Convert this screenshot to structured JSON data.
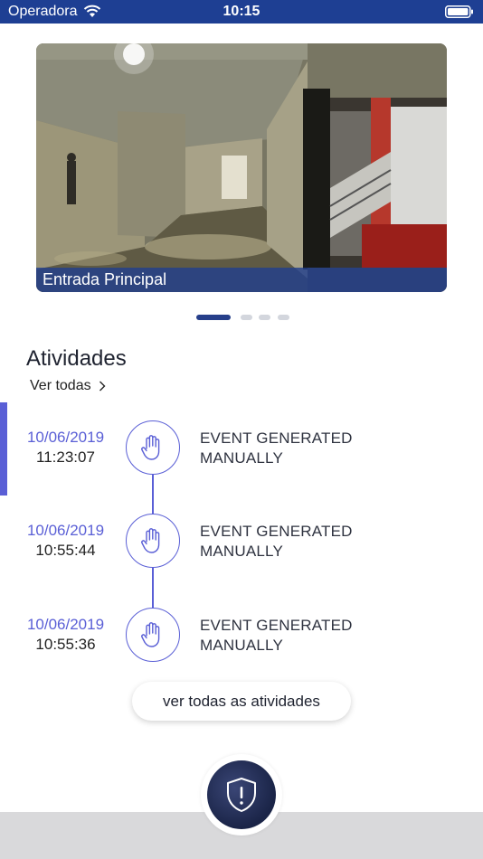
{
  "status_bar": {
    "carrier": "Operadora",
    "time": "10:15"
  },
  "camera": {
    "caption": "Entrada Principal",
    "pages": 4,
    "active_page": 1
  },
  "activities": {
    "title": "Atividades",
    "see_all_link": "Ver todas",
    "events": [
      {
        "date": "10/06/2019",
        "time": "11:23:07",
        "line1": "EVENT GENERATED",
        "line2": "MANUALLY",
        "icon": "hand-icon"
      },
      {
        "date": "10/06/2019",
        "time": "10:55:44",
        "line1": "EVENT GENERATED",
        "line2": "MANUALLY",
        "icon": "hand-icon"
      },
      {
        "date": "10/06/2019",
        "time": "10:55:36",
        "line1": "EVENT GENERATED",
        "line2": "MANUALLY",
        "icon": "hand-icon"
      }
    ],
    "all_button": "ver todas as atividades"
  },
  "panic": {
    "icon": "shield-alert-icon"
  },
  "colors": {
    "status_bar": "#1e3f93",
    "accent": "#5a5fd6",
    "panic": "#1a2447"
  }
}
